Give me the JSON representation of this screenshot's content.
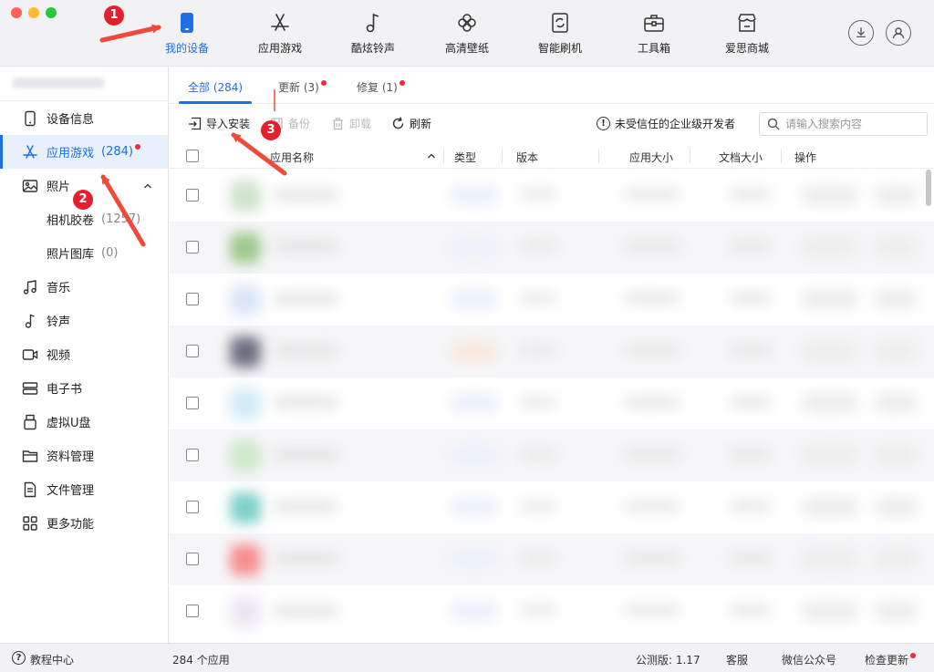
{
  "top_nav": [
    {
      "label": "我的设备",
      "icon": "phone-icon",
      "active": true
    },
    {
      "label": "应用游戏",
      "icon": "appstore-icon"
    },
    {
      "label": "酷炫铃声",
      "icon": "music-note-icon"
    },
    {
      "label": "高清壁纸",
      "icon": "flower-icon"
    },
    {
      "label": "智能刷机",
      "icon": "flash-icon"
    },
    {
      "label": "工具箱",
      "icon": "toolbox-icon"
    },
    {
      "label": "爱思商城",
      "icon": "store-icon"
    }
  ],
  "sidebar": {
    "items": [
      {
        "label": "设备信息",
        "icon": "device-info-icon"
      },
      {
        "label": "应用游戏",
        "count": "(284)",
        "icon": "appstore-icon",
        "active": true
      },
      {
        "label": "照片",
        "icon": "photo-icon"
      },
      {
        "label": "相机胶卷",
        "count": "(1257)"
      },
      {
        "label": "照片图库",
        "count": "(0)"
      },
      {
        "label": "音乐",
        "icon": "music-icon"
      },
      {
        "label": "铃声",
        "icon": "ringtone-icon"
      },
      {
        "label": "视频",
        "icon": "video-icon"
      },
      {
        "label": "电子书",
        "icon": "book-icon"
      },
      {
        "label": "虚拟U盘",
        "icon": "usb-icon"
      },
      {
        "label": "资料管理",
        "icon": "folder-icon"
      },
      {
        "label": "文件管理",
        "icon": "file-icon"
      },
      {
        "label": "更多功能",
        "icon": "grid-icon"
      }
    ]
  },
  "tabs": [
    {
      "label": "全部 (284)",
      "active": true
    },
    {
      "label": "更新 (3)"
    },
    {
      "label": "修复 (1)"
    }
  ],
  "actions": {
    "import": "导入安装",
    "backup": "备份",
    "uninstall": "卸载",
    "refresh": "刷新",
    "untrusted": "未受信任的企业级开发者",
    "search_placeholder": "请输入搜索内容"
  },
  "table": {
    "headers": [
      "应用名称",
      "类型",
      "版本",
      "应用大小",
      "文档大小",
      "操作"
    ]
  },
  "statusbar": {
    "help": "教程中心",
    "count": "284 个应用",
    "version": "公测版: 1.17",
    "service": "客服",
    "wechat": "微信公众号",
    "update": "检查更新"
  },
  "annotations": [
    "1",
    "2",
    "3"
  ],
  "colors": {
    "accent": "#1f6fe5",
    "badge": "#e5202e",
    "arrow": "#f04a3c"
  }
}
